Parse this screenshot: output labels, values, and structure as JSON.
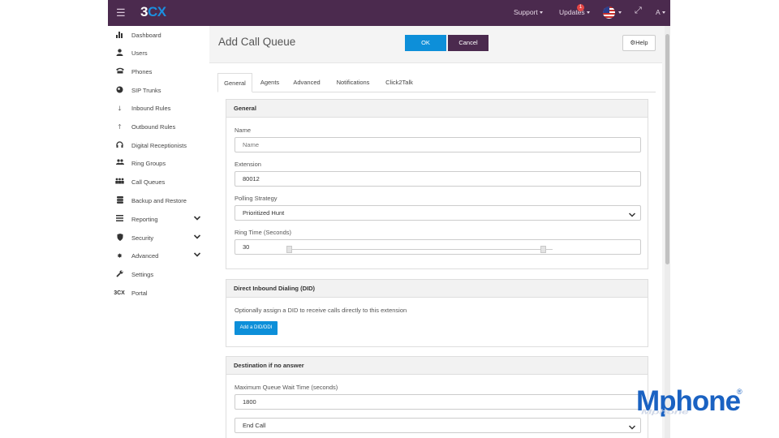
{
  "header": {
    "logo": {
      "part1": "3",
      "part2": "CX"
    },
    "support_label": "Support",
    "updates_label": "Updates",
    "updates_count": "1",
    "user_initial": "A"
  },
  "sidebar": {
    "items": [
      {
        "label": "Dashboard",
        "icon": "bar-chart-icon"
      },
      {
        "label": "Users",
        "icon": "user-icon"
      },
      {
        "label": "Phones",
        "icon": "phone-icon"
      },
      {
        "label": "SIP Trunks",
        "icon": "globe-icon"
      },
      {
        "label": "Inbound Rules",
        "icon": "arrow-down-icon"
      },
      {
        "label": "Outbound Rules",
        "icon": "arrow-up-icon"
      },
      {
        "label": "Digital Receptionists",
        "icon": "headset-icon"
      },
      {
        "label": "Ring Groups",
        "icon": "group-icon"
      },
      {
        "label": "Call Queues",
        "icon": "queue-icon"
      },
      {
        "label": "Backup and Restore",
        "icon": "database-icon"
      },
      {
        "label": "Reporting",
        "icon": "list-icon"
      },
      {
        "label": "Security",
        "icon": "shield-icon"
      },
      {
        "label": "Advanced",
        "icon": "cog-icon"
      },
      {
        "label": "Settings",
        "icon": "wrench-icon"
      },
      {
        "label": "Portal",
        "icon": "portal-3cx-icon",
        "icon_text": "3CX"
      }
    ]
  },
  "page": {
    "title": "Add Call Queue",
    "ok_label": "OK",
    "cancel_label": "Cancel",
    "help_label": "Help"
  },
  "tabs": [
    {
      "label": "General",
      "active": true
    },
    {
      "label": "Agents"
    },
    {
      "label": "Advanced"
    },
    {
      "label": "Notifications"
    },
    {
      "label": "Click2Talk"
    }
  ],
  "general": {
    "heading": "General",
    "name_label": "Name",
    "name_placeholder": "Name",
    "extension_label": "Extension",
    "extension_value": "80012",
    "polling_label": "Polling Strategy",
    "polling_value": "Prioritized Hunt",
    "ring_time_label": "Ring Time (Seconds)",
    "ring_time_value": "30"
  },
  "did": {
    "heading": "Direct Inbound Dialing (DID)",
    "description": "Optionally assign a DID to receive calls directly to this extension",
    "add_button": "Add a DID/DDI"
  },
  "no_answer": {
    "heading": "Destination if no answer",
    "max_wait_label": "Maximum Queue Wait Time (seconds)",
    "max_wait_value": "1800",
    "destination_value": "End Call"
  },
  "watermark": {
    "text": "Mphone",
    "registered": "®",
    "reflection": "Mphone"
  },
  "colors": {
    "topbar": "#4b2a4e",
    "primary": "#0d8fd9",
    "cancel": "#4b2a4e",
    "watermark": "#1a62c2"
  }
}
